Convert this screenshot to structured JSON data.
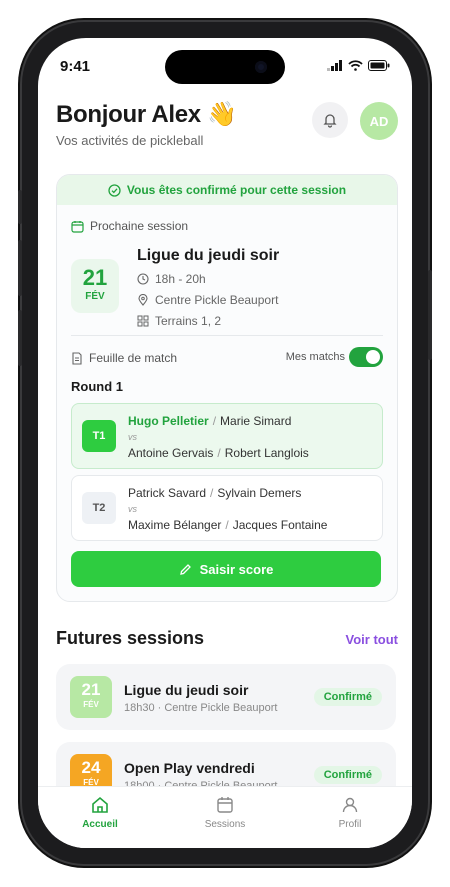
{
  "status": {
    "time": "9:41"
  },
  "header": {
    "greeting": "Bonjour Alex 👋",
    "subtitle": "Vos activités de pickleball",
    "avatar_initials": "AD"
  },
  "confirmation_banner": "Vous êtes confirmé pour cette session",
  "next_session": {
    "label": "Prochaine session",
    "day": "21",
    "month": "FÉV",
    "title": "Ligue du jeudi soir",
    "time": "18h - 20h",
    "location": "Centre Pickle Beauport",
    "courts": "Terrains 1, 2"
  },
  "match_sheet": {
    "label": "Feuille de match",
    "toggle_label": "Mes matchs",
    "toggle_on": true,
    "round_label": "Round 1",
    "matches": [
      {
        "court": "T1",
        "team1": [
          "Hugo Pelletier",
          "Marie Simard"
        ],
        "vs": "vs",
        "team2": [
          "Antoine Gervais",
          "Robert Langlois"
        ]
      },
      {
        "court": "T2",
        "team1": [
          "Patrick Savard",
          "Sylvain Demers"
        ],
        "vs": "vs",
        "team2": [
          "Maxime Bélanger",
          "Jacques Fontaine"
        ]
      }
    ],
    "score_button": "Saisir score"
  },
  "future": {
    "title": "Futures sessions",
    "see_all": "Voir tout",
    "items": [
      {
        "day": "21",
        "month": "FÉV",
        "title": "Ligue du jeudi soir",
        "subtitle": "18h30 · Centre Pickle Beauport",
        "badge": "Confirmé",
        "color": "#b7e8a4"
      },
      {
        "day": "24",
        "month": "FÉV",
        "title": "Open Play vendredi",
        "subtitle": "18h00 · Centre Pickle Beauport",
        "badge": "Confirmé",
        "color": "#f5a623"
      }
    ]
  },
  "tabs": {
    "home": "Accueil",
    "sessions": "Sessions",
    "profile": "Profil"
  },
  "colors": {
    "accent": "#2ecc40",
    "accent_dark": "#22a33e",
    "link": "#8a4fe0"
  }
}
